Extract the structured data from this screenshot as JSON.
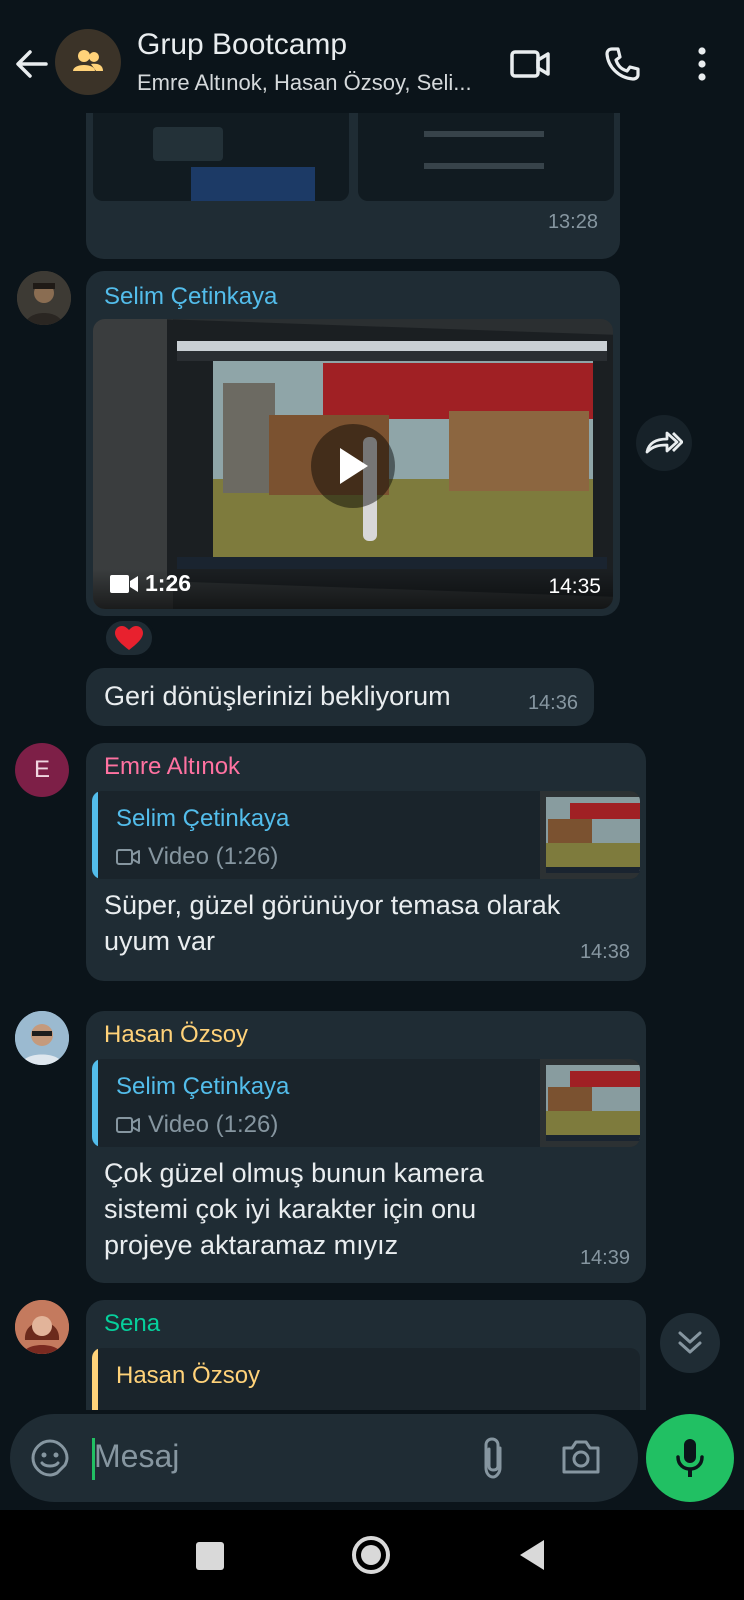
{
  "header": {
    "title": "Grup Bootcamp",
    "subtitle": "Emre Altınok, Hasan Özsoy, Seli..."
  },
  "messages": {
    "m0": {
      "time": "13:28"
    },
    "m1": {
      "sender": "Selim Çetinkaya",
      "duration": "1:26",
      "time": "14:35",
      "reaction": "❤️"
    },
    "m2": {
      "text": "Geri dönüşlerinizi bekliyorum",
      "time": "14:36"
    },
    "m3": {
      "avatar_letter": "E",
      "sender": "Emre Altınok",
      "quote_name": "Selim Çetinkaya",
      "quote_sub": "Video (1:26)",
      "text_line1": "Süper, güzel görünüyor temasa olarak",
      "text_line2": "uyum var",
      "time": "14:38"
    },
    "m4": {
      "sender": "Hasan Özsoy",
      "quote_name": "Selim Çetinkaya",
      "quote_sub": "Video (1:26)",
      "text_line1": "Çok güzel olmuş bunun kamera",
      "text_line2": "sistemi çok iyi karakter için onu",
      "text_line3": "projeye aktaramaz mıyız",
      "time": "14:39"
    },
    "m5": {
      "sender": "Sena",
      "quote_name": "Hasan Özsoy"
    }
  },
  "composer": {
    "placeholder": "Mesaj"
  },
  "colors": {
    "selim": "#53bdeb",
    "emre": "#ff72a1",
    "hasan": "#ffd279",
    "sena": "#06cf9c",
    "accent": "#21c063"
  },
  "icons": [
    "back-arrow-icon",
    "group-icon",
    "video-call-icon",
    "phone-icon",
    "more-vert-icon",
    "forward-icon",
    "play-icon",
    "video-camera-icon",
    "scroll-down-icon",
    "sticker-icon",
    "attach-icon",
    "camera-icon",
    "mic-icon",
    "nav-square-icon",
    "nav-circle-icon",
    "nav-back-icon"
  ]
}
